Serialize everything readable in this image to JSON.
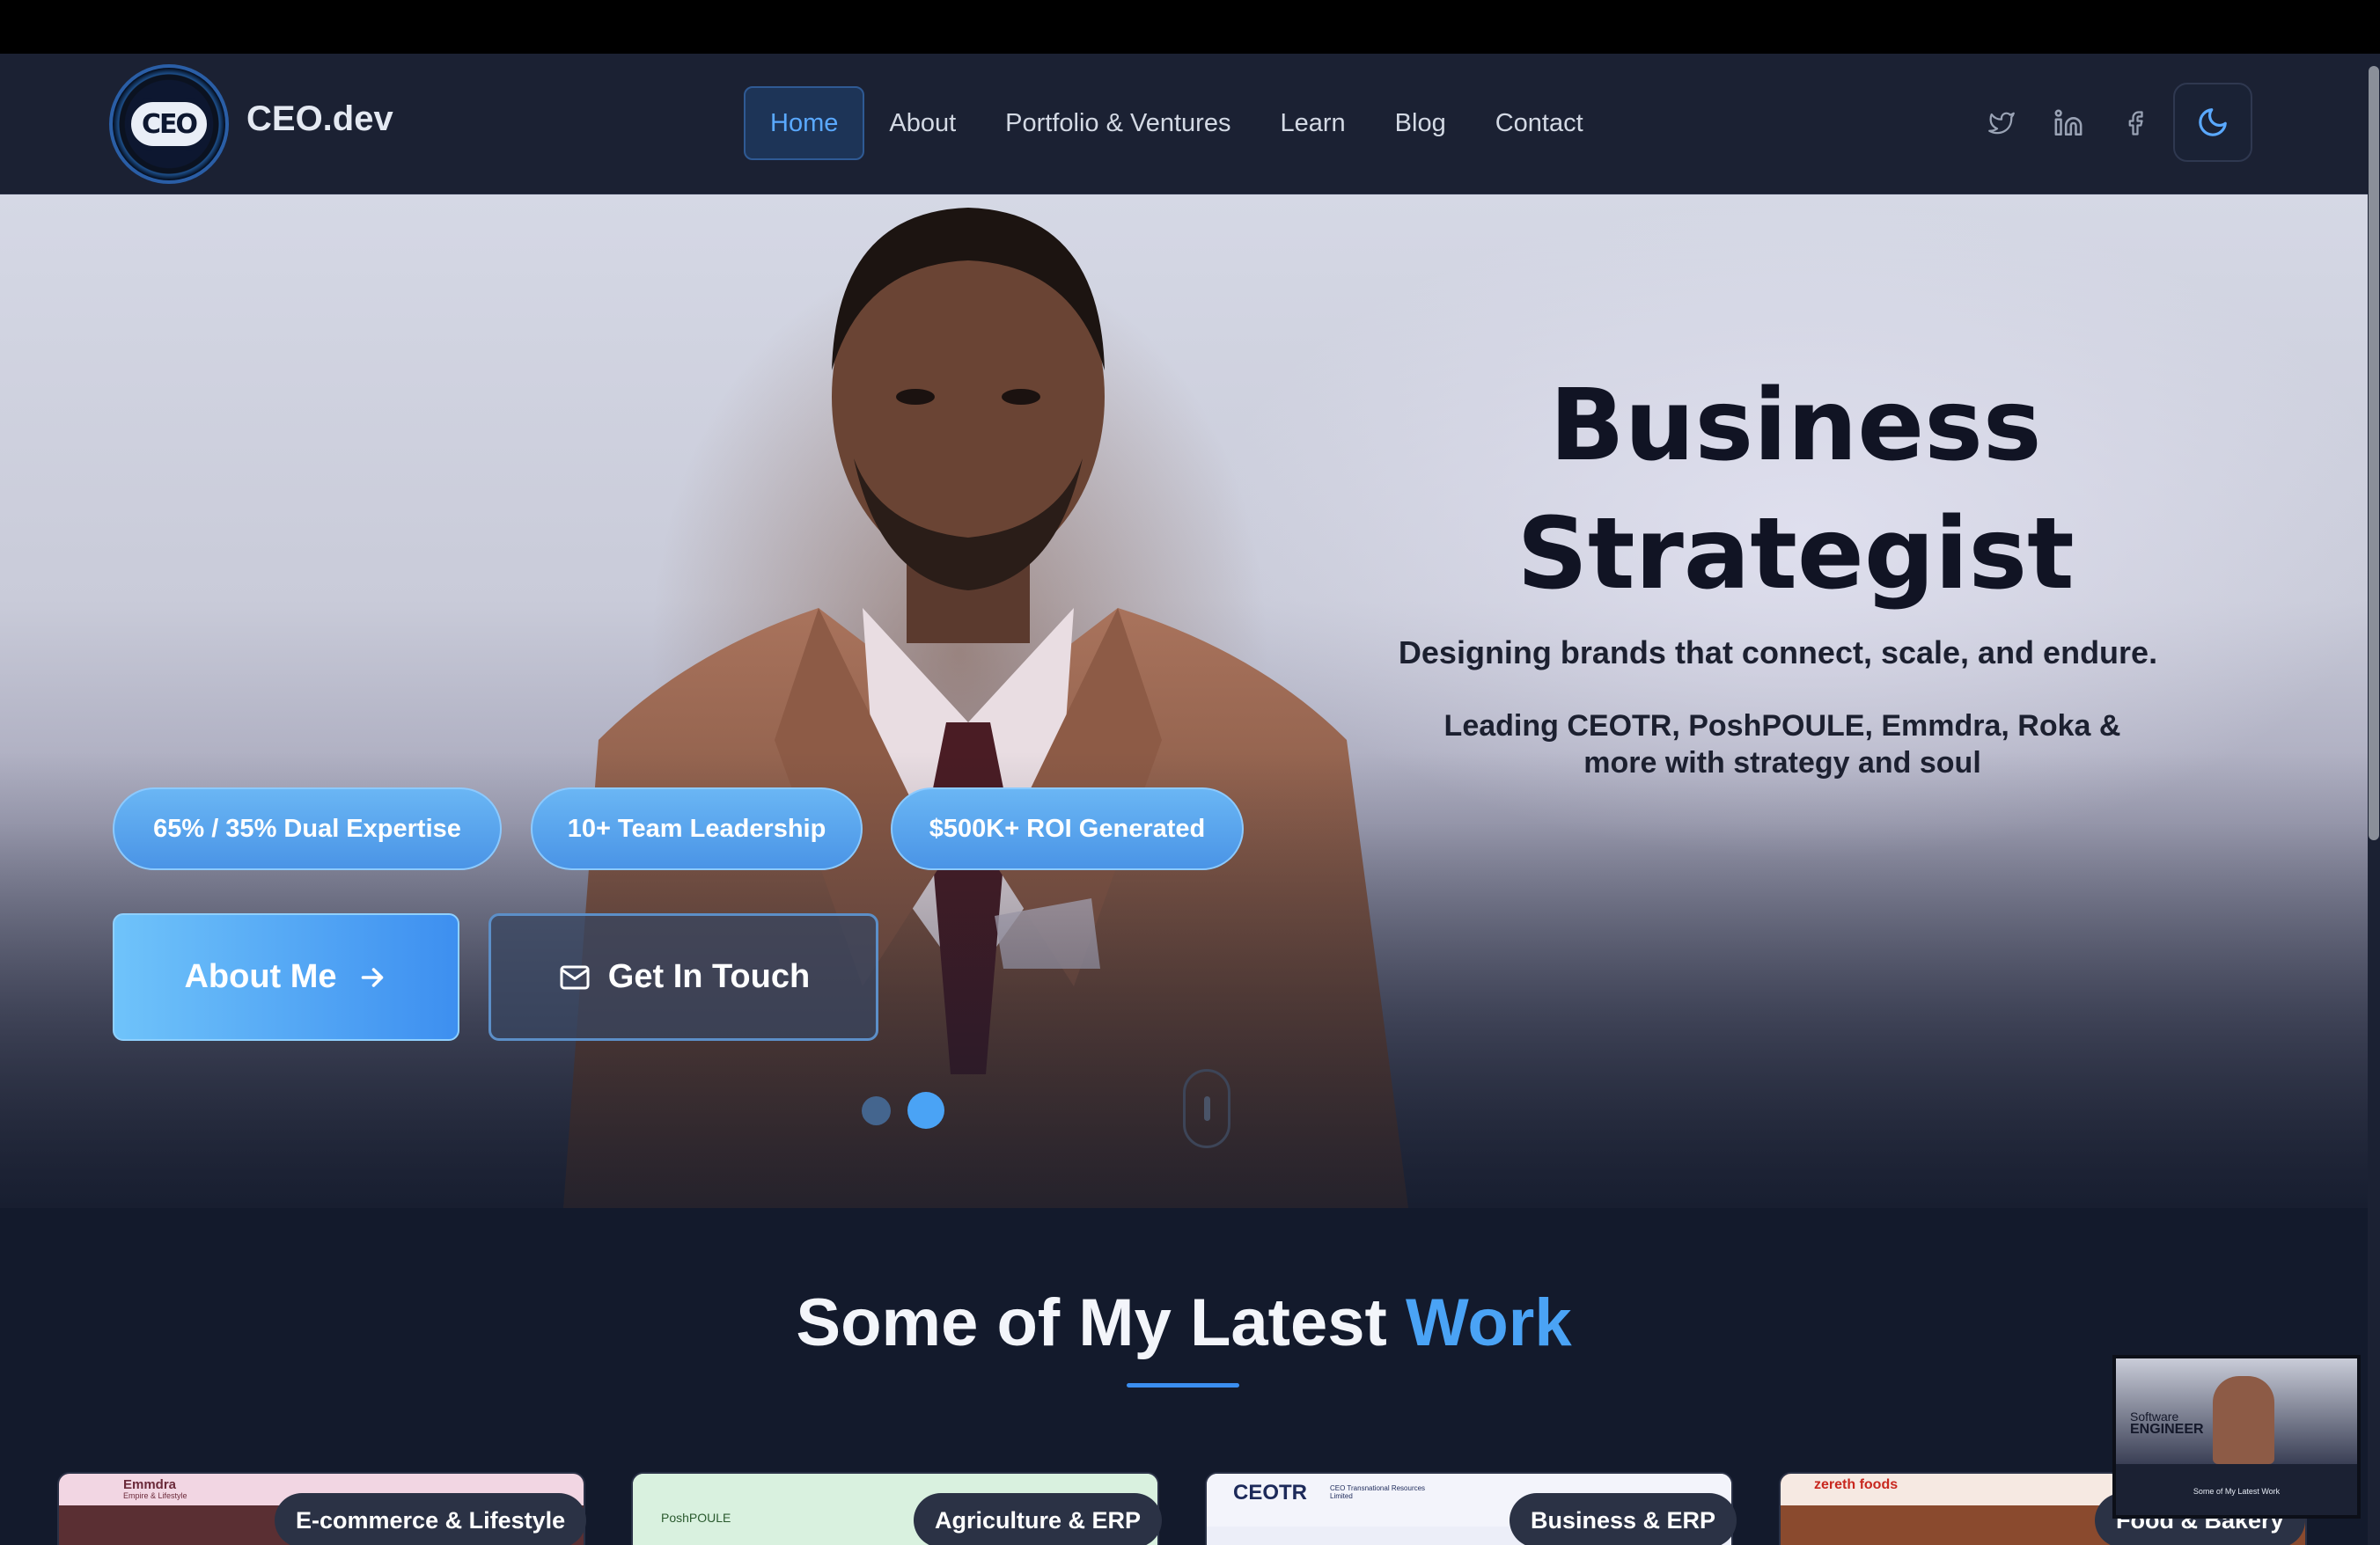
{
  "brand": {
    "name": "CEO.dev",
    "logo_text": "CEO"
  },
  "nav": {
    "items": [
      {
        "label": "Home",
        "active": true
      },
      {
        "label": "About"
      },
      {
        "label": "Portfolio & Ventures"
      },
      {
        "label": "Learn"
      },
      {
        "label": "Blog"
      },
      {
        "label": "Contact"
      }
    ],
    "social_icons": [
      "twitter-icon",
      "linkedin-icon",
      "facebook-icon"
    ],
    "theme_toggle_icon": "moon-icon"
  },
  "hero": {
    "headline_line1": "Business",
    "headline_line2": "Strategist",
    "tagline": "Designing brands that connect, scale, and endure.",
    "subline": "Leading CEOTR, PoshPOULE, Emmdra, Roka & more with strategy and soul",
    "stats": [
      {
        "label": "65% / 35% Dual Expertise"
      },
      {
        "label": "10+ Team Leadership"
      },
      {
        "label": "$500K+ ROI Generated"
      }
    ],
    "primary_button": "About Me",
    "secondary_button": "Get In Touch",
    "slides_total": 2,
    "slide_active": 2
  },
  "work": {
    "title_plain": "Some of My Latest",
    "title_accent": "Work",
    "cards": [
      {
        "tag": "E-commerce & Lifestyle",
        "site": "Emmdra",
        "site_sub": "Empire & Lifestyle"
      },
      {
        "tag": "Agriculture & ERP",
        "site": "PoshPOULE"
      },
      {
        "tag": "Business & ERP",
        "site": "CEOTR",
        "site_sub": "CEO Transnational Resources Limited"
      },
      {
        "tag": "Food & Bakery",
        "site": "zereth foods"
      }
    ]
  },
  "preview_thumbnail": {
    "line1": "Software",
    "line2": "ENGINEER",
    "caption": "Some of My Latest Work"
  },
  "colors": {
    "accent": "#4aa3f5",
    "nav_bg": "#1b2133",
    "page_bg": "#131a2c"
  }
}
